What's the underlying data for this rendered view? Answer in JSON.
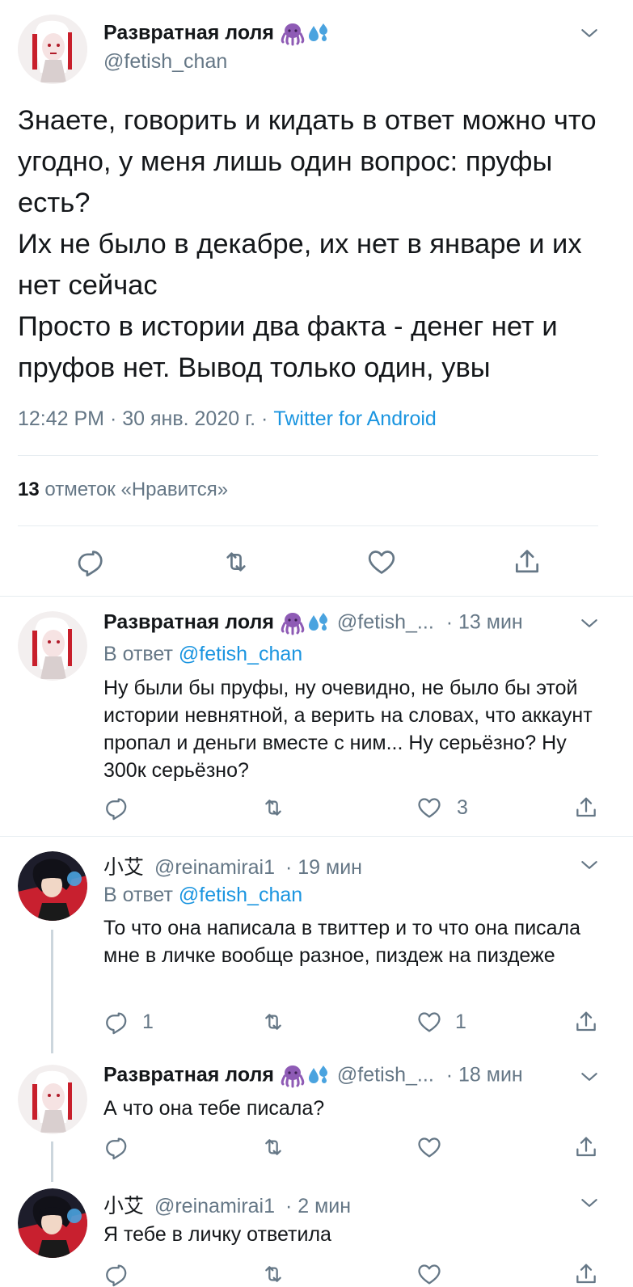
{
  "main_tweet": {
    "author_name": "Развратная лоля",
    "handle": "@fetish_chan",
    "text": "Знаете, говорить и кидать в ответ можно что угодно, у меня лишь один вопрос: пруфы есть?\nИх не было в декабре, их нет в январе и их нет сейчас\nПросто в истории два факта - денег нет и пруфов нет. Вывод только один, увы",
    "time": "12:42 PM",
    "date": "30 янв. 2020 г.",
    "source": "Twitter for Android",
    "likes_count": "13",
    "likes_label": "отметок «Нравится»"
  },
  "replies": [
    {
      "author_name": "Развратная лоля",
      "handle": "@fetish_...",
      "time": "13 мин",
      "reply_to_prefix": "В ответ",
      "reply_to": "@fetish_chan",
      "text": "Ну были бы пруфы, ну очевидно, не было бы этой истории невнятной, а верить на словах, что аккаунт пропал и деньги вместе с ним... Ну серьёзно? Ну 300к серьёзно?",
      "reply_count": "",
      "like_count": "3"
    },
    {
      "author_name": "小艾",
      "handle": "@reinamirai1",
      "time": "19 мин",
      "reply_to_prefix": "В ответ",
      "reply_to": "@fetish_chan",
      "text": "То что она написала в твиттер и то что она писала мне в личке вообще разное, пиздеж на пиздеже",
      "reply_count": "1",
      "like_count": "1"
    },
    {
      "author_name": "Развратная лоля",
      "handle": "@fetish_...",
      "time": "18 мин",
      "text": "А что она тебе писала?",
      "reply_count": "",
      "like_count": ""
    },
    {
      "author_name": "小艾",
      "handle": "@reinamirai1",
      "time": "2 мин",
      "text": "Я тебе в личку ответила"
    }
  ],
  "separator_dot": "·",
  "icons": [
    "chevron-down-icon",
    "reply-icon",
    "retweet-icon",
    "like-icon",
    "share-icon",
    "octopus-emoji",
    "sweat-drops-emoji"
  ],
  "colors": {
    "text": "#14171a",
    "muted": "#657786",
    "link": "#1b95e0",
    "divider": "#e6ecf0",
    "emoji_purple": "#8e5bb5",
    "emoji_blue": "#4aa3df"
  }
}
